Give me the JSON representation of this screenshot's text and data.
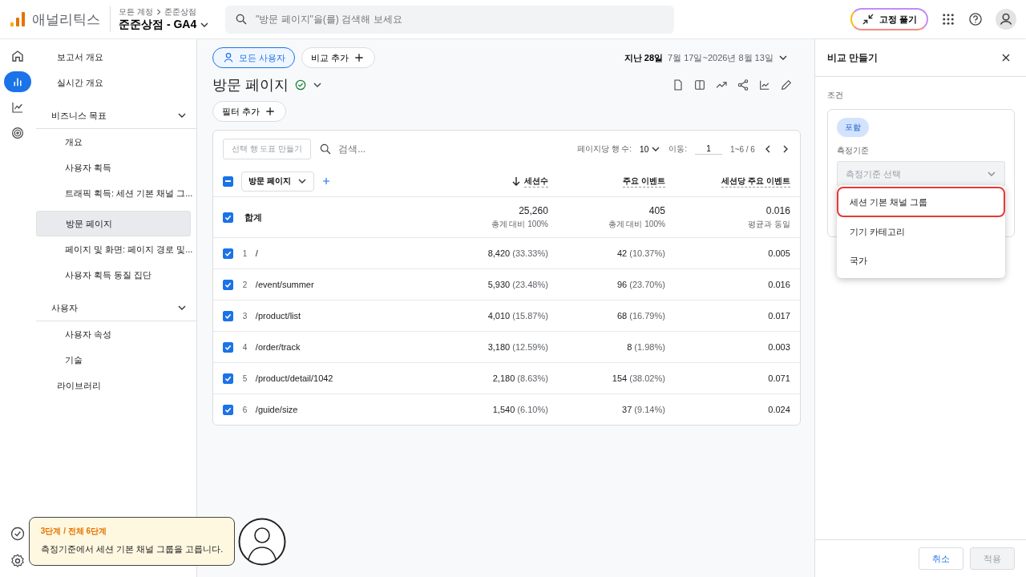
{
  "header": {
    "product": "애널리틱스",
    "breadcrumb": [
      "모든 계정",
      "준준상점"
    ],
    "property": "준준상점 - GA4",
    "search_placeholder": "\"방문 페이지\"을(를) 검색해 보세요",
    "unpin_button": "고정 풀기"
  },
  "rail": [
    {
      "selected": false
    },
    {
      "selected": true
    },
    {
      "selected": false
    },
    {
      "selected": false
    }
  ],
  "nav": [
    {
      "label": "보고서 개요",
      "selected": false
    },
    {
      "label": "실시간 개요",
      "selected": false
    },
    {
      "label": "비즈니스 목표",
      "expanded": true,
      "children": [
        {
          "label": "개요",
          "selected": false
        },
        {
          "label": "사용자 획득",
          "selected": false
        },
        {
          "label": "트래픽 획득: 세션 기본 채널 그...",
          "selected": false
        },
        {
          "label": "방문 페이지",
          "selected": true
        },
        {
          "label": "페이지 및 화면: 페이지 경로 및...",
          "selected": false
        },
        {
          "label": "사용자 획득 동질 집단",
          "selected": false
        }
      ]
    },
    {
      "label": "사용자",
      "expanded": true,
      "children": [
        {
          "label": "사용자 속성",
          "selected": false
        },
        {
          "label": "기술",
          "selected": false
        }
      ]
    },
    {
      "label": "라이브러리",
      "selected": false
    }
  ],
  "report": {
    "segment": "모든 사용자",
    "add_comparison": "비교 추가",
    "date_label": "지난 28일",
    "date_range": "7월 17일~2026년 8월 13일",
    "title": "방문 페이지",
    "add_filter": "필터 추가"
  },
  "table": {
    "chart_button": "선택 행 도표 만들기",
    "search_placeholder": "검색...",
    "rows_per_page_label": "페이지당 행 수:",
    "rows_per_page": "10",
    "goto_label": "이동:",
    "goto_value": "1",
    "range": "1~6 / 6",
    "header_indeterminate": true,
    "dimension": "방문 페이지",
    "columns": [
      {
        "label": "세션수",
        "sorted": true
      },
      {
        "label": "주요 이벤트",
        "sorted": false
      },
      {
        "label": "세션당 주요 이벤트",
        "sorted": false
      }
    ],
    "total": {
      "label": "합계",
      "checked": true,
      "cells": [
        {
          "value": "25,260",
          "sub": "총계 대비 100%"
        },
        {
          "value": "405",
          "sub": "총계 대비 100%"
        },
        {
          "value": "0.016",
          "sub": "평균과 동일"
        }
      ]
    },
    "rows": [
      {
        "index": "1",
        "page": "/",
        "checked": true,
        "sessions": "8,420",
        "sessions_pct": "(33.33%)",
        "events": "42",
        "events_pct": "(10.37%)",
        "rate": "0.005"
      },
      {
        "index": "2",
        "page": "/event/summer",
        "checked": true,
        "sessions": "5,930",
        "sessions_pct": "(23.48%)",
        "events": "96",
        "events_pct": "(23.70%)",
        "rate": "0.016"
      },
      {
        "index": "3",
        "page": "/product/list",
        "checked": true,
        "sessions": "4,010",
        "sessions_pct": "(15.87%)",
        "events": "68",
        "events_pct": "(16.79%)",
        "rate": "0.017"
      },
      {
        "index": "4",
        "page": "/order/track",
        "checked": true,
        "sessions": "3,180",
        "sessions_pct": "(12.59%)",
        "events": "8",
        "events_pct": "(1.98%)",
        "rate": "0.003"
      },
      {
        "index": "5",
        "page": "/product/detail/1042",
        "checked": true,
        "sessions": "2,180",
        "sessions_pct": "(8.63%)",
        "events": "154",
        "events_pct": "(38.02%)",
        "rate": "0.071"
      },
      {
        "index": "6",
        "page": "/guide/size",
        "checked": true,
        "sessions": "1,540",
        "sessions_pct": "(6.10%)",
        "events": "37",
        "events_pct": "(9.14%)",
        "rate": "0.024"
      }
    ]
  },
  "panel": {
    "title": "비교 만들기",
    "condition_label": "조건",
    "include_chip": "포함",
    "dimension_label": "측정기준",
    "dimension_placeholder": "측정기준 선택",
    "options": [
      {
        "label": "세션 기본 채널 그룹",
        "highlighted": true
      },
      {
        "label": "기기 카테고리",
        "highlighted": false
      },
      {
        "label": "국가",
        "highlighted": false
      }
    ],
    "cancel": "취소",
    "apply": "적용",
    "apply_disabled": true
  },
  "tour": {
    "step": "3단계 / 전체 6단계",
    "message": "측정기준에서 세션 기본 채널 그룹을 고릅니다."
  }
}
